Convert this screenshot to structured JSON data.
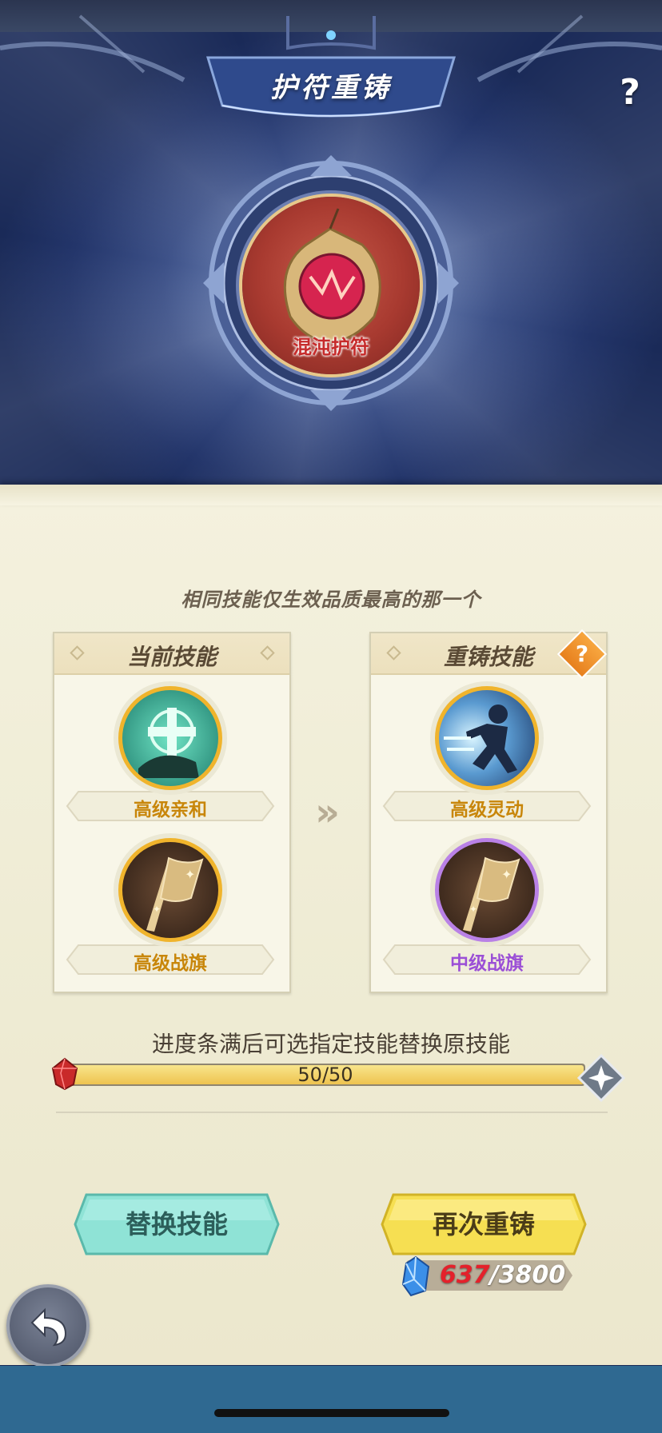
{
  "header": {
    "title": "护符重铸",
    "help_icon": "question-mark-icon"
  },
  "amulet": {
    "name": "混沌护符",
    "icon": "chaos-amulet-icon"
  },
  "note": "相同技能仅生效品质最高的那一个",
  "current_skills": {
    "title": "当前技能",
    "items": [
      {
        "label": "高级亲和",
        "icon": "affinity-cross-icon",
        "color": "#c8860a"
      },
      {
        "label": "高级战旗",
        "icon": "war-banner-icon",
        "color": "#c8860a"
      }
    ]
  },
  "reforge_skills": {
    "title": "重铸技能",
    "help_icon": "orange-question-icon",
    "items": [
      {
        "label": "高级灵动",
        "icon": "agility-runner-icon",
        "color": "#c8860a"
      },
      {
        "label": "中级战旗",
        "icon": "war-banner-icon",
        "color": "#9b4fd6"
      }
    ]
  },
  "progress": {
    "description": "进度条满后可选指定技能替换原技能",
    "text": "50/50",
    "fraction": 1.0
  },
  "buttons": {
    "replace_label": "替换技能",
    "reforge_label": "再次重铸"
  },
  "cost": {
    "current": "637",
    "total": "/3800",
    "icon": "blue-crystal-icon"
  },
  "back_icon": "back-arrow-icon"
}
